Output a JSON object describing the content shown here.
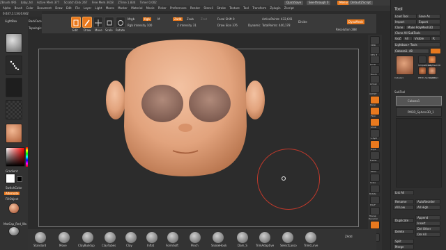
{
  "titlebar": {
    "items": [
      "ZBrush 4R6",
      "baby_hd",
      "Active Mem 377",
      "Scratch Disk 267",
      "Free Mem 3618",
      "ZTime 1.834",
      "Timer 0.002"
    ],
    "quicksave": "QuickSave",
    "seethrough": "See-through  0",
    "menus": "Menus",
    "script": "DefaultZScript"
  },
  "menubar": [
    "Alpha",
    "Brush",
    "Color",
    "Document",
    "Draw",
    "Edit",
    "File",
    "Layer",
    "Light",
    "Macro",
    "Marker",
    "Material",
    "Movie",
    "Picker",
    "Preferences",
    "Render",
    "Stencil",
    "Stroke",
    "Texture",
    "Tool",
    "Transform",
    "Zplugin",
    "Zscript"
  ],
  "readout": "0.637,1.134,0.642",
  "left": {
    "lightbox": "LightBox",
    "backface": "BackFaceMas",
    "topological": "Topological",
    "gradient": "Gradient",
    "switchcolor": "SwitchColor",
    "alternate": "Alternate",
    "fillobject": "FillObject",
    "matcap": "MatCap_Red_Wa",
    "brush_label": "Standard"
  },
  "shelf": {
    "edit": "Edit",
    "draw": "Draw",
    "move": "Move",
    "scale": "Scale",
    "rotate": "Rotate",
    "mrgb": "Mrgb",
    "rgb": "Rgb",
    "m": "M",
    "zadd": "Zadd",
    "zsub": "Zsub",
    "zcut": "Zcut",
    "rgb_intensity": "Rgb Intensity 100",
    "z_intensity": "Z Intensity 31",
    "focal_shift": "Focal Shift 0",
    "draw_size": "Draw Size 376",
    "dynamic": "Dynamic",
    "active_points": "ActivePoints: 432,641",
    "total_points": "TotalPoints: 440,178",
    "divide": "Divide",
    "dynamesh": "DynaMesh",
    "resolution": "Resolution 288"
  },
  "rightstrip": [
    "BPR",
    "SPix 3",
    "Scroll",
    "Zoom",
    "Actual",
    "AAHalf",
    "Persp",
    "Floor",
    "Local",
    "L.Sym",
    "Gxyz",
    "Frame",
    "Move",
    "Scale",
    "Rotate",
    "PolyF",
    "Transp",
    "Dynamic",
    "Solo",
    "Xpose"
  ],
  "tool": {
    "title": "Tool",
    "load": "Load Tool",
    "save": "Save As",
    "import": "Import",
    "export": "Export",
    "clone": "Clone",
    "make_poly": "Make PolyMesh3D",
    "goz": "GoZ",
    "all": "All",
    "visible": "Visible",
    "r": "R",
    "clone_all": "Clone All SubTools",
    "lightbox_tools": "Lightbox> Tools",
    "tool_name": "Cabeza1. 48",
    "thumb1": "Cabeza1",
    "thumb2": "SimpleBrush",
    "thumb3": "PolyMesh3D",
    "thumb4": "PM3D_Sphere3D",
    "thumb5": "Cabeza1",
    "subtool": "SubTool",
    "subtool_item1": "Cabeza1",
    "subtool_item2": "PM3D_Sphere3D_1",
    "list_all": "List All",
    "rename": "Rename",
    "autoreorder": "AutoReorder",
    "all_low": "All Low",
    "all_high": "All High",
    "duplicate": "Duplicate",
    "append": "Append",
    "insert": "Insert",
    "delete": "Delete",
    "del_other": "Del Other",
    "del_all": "Del All",
    "split": "Split",
    "merge": "Merge"
  },
  "bottom": {
    "brushes": [
      "Standard",
      "Move",
      "ClayBuildup",
      "ClayTubes",
      "Clay",
      "Inflat",
      "FormSoft",
      "Pinch",
      "SnakeHook",
      "Dam_S",
      "TrimAdaptive",
      "SelectLasso",
      "TrimCurve"
    ],
    "right_label": "ZAdd"
  },
  "colors": {
    "accent": "#e8791e",
    "skin": "#e2a37d",
    "eye": "#a07c6e",
    "brush_ring": "#c0392b"
  }
}
